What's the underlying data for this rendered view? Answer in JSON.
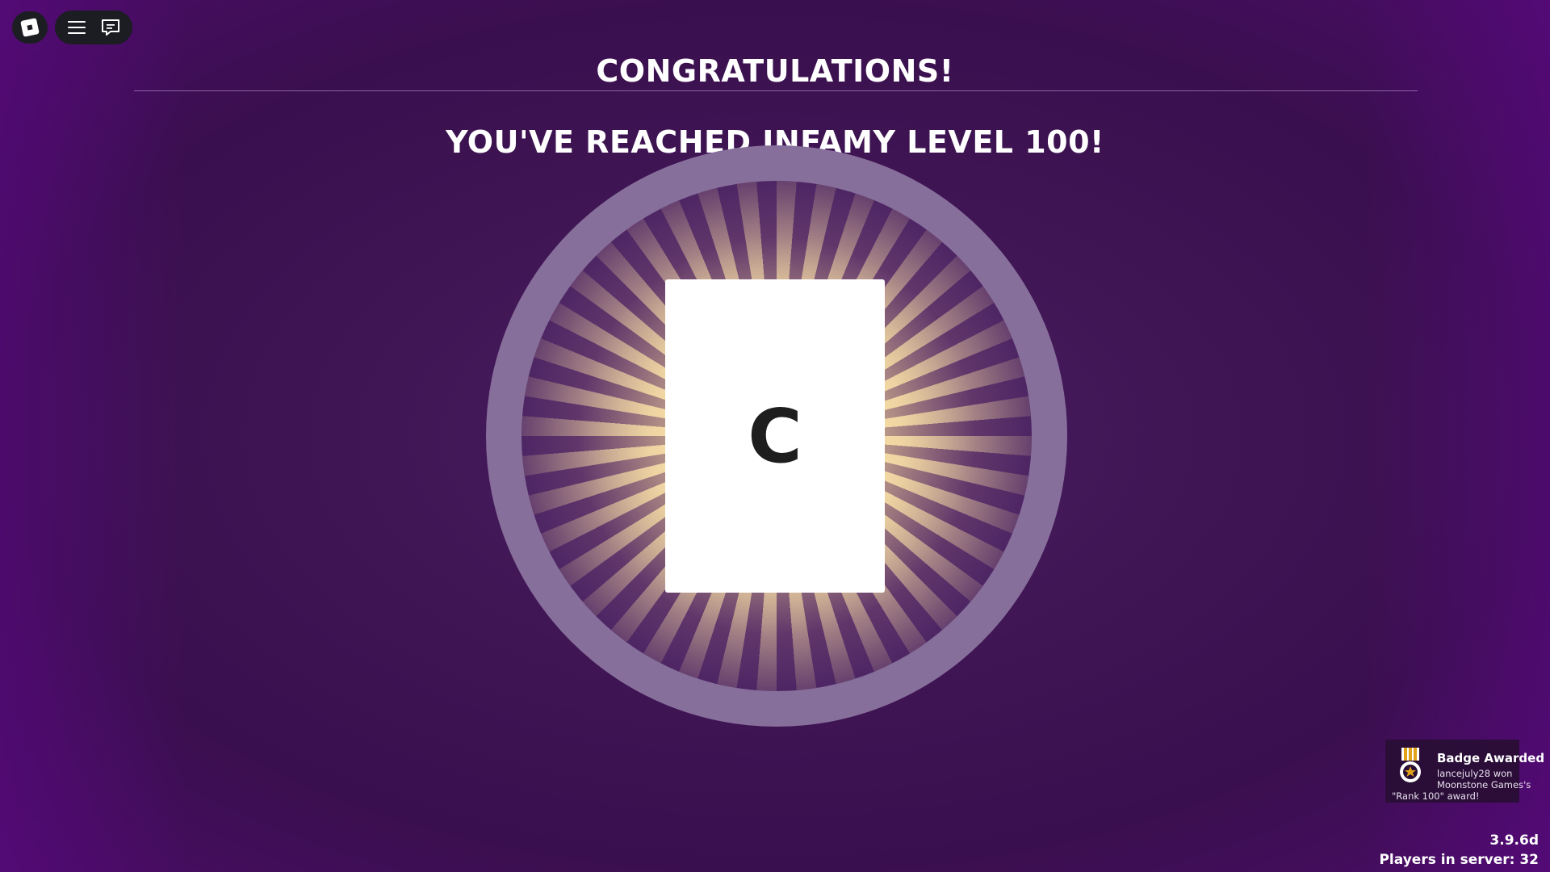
{
  "hud": {
    "menu_icon": "hamburger-menu-icon",
    "chat_icon": "chat-icon",
    "logo_icon": "roblox-logo-icon"
  },
  "reward": {
    "title": "CONGRATULATIONS!",
    "subtitle": "YOU'VE REACHED INFAMY LEVEL 100!",
    "card_letter": "C",
    "ray_color": "#ffe8aa",
    "ring_color": "#876f9c"
  },
  "badge_toast": {
    "title": "Badge Awarded",
    "line1": "lancejuly28 won",
    "line2": "Moonstone Games's",
    "line3": "\"Rank 100\" award!",
    "icon": "medal-badge-icon"
  },
  "server": {
    "version": "3.9.6d",
    "players": "Players in server: 32"
  },
  "colors": {
    "background": "#3f1553",
    "edge": "#5a0882"
  }
}
